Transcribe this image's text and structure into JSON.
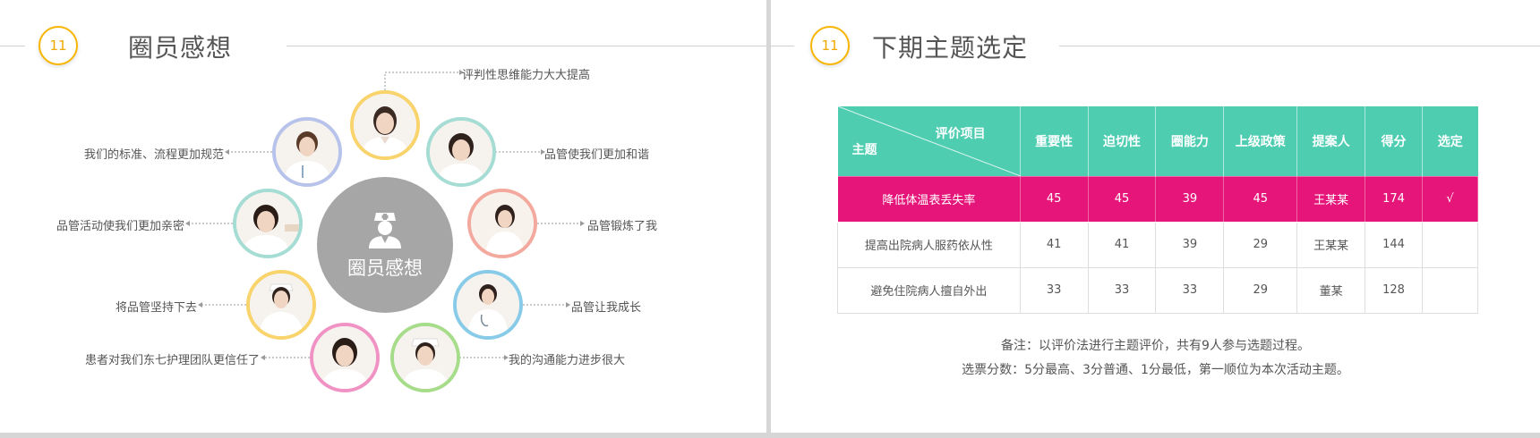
{
  "left": {
    "number": "11",
    "title": "圈员感想",
    "center_label": "圈员感想",
    "quotes": [
      "评判性思维能力大大提高",
      "品管使我们更加和谐",
      "品管锻炼了我",
      "品管让我成长",
      "我的沟通能力进步很大",
      "患者对我们东七护理团队更信任了",
      "将品管坚持下去",
      "品管活动使我们更加亲密",
      "我们的标准、流程更加规范"
    ],
    "photo_ring_colors": [
      "#f9d36b",
      "#a5dcd3",
      "#f3a99d",
      "#88cbe8",
      "#a6dc8a",
      "#f093c4",
      "#f9d36b",
      "#a5dcd3",
      "#b7c3ea"
    ]
  },
  "right": {
    "number": "11",
    "title": "下期主题选定",
    "table": {
      "diag_top": "评价项目",
      "diag_bottom": "主题",
      "headers": [
        "重要性",
        "迫切性",
        "圈能力",
        "上级政策",
        "提案人",
        "得分",
        "选定"
      ],
      "rows": [
        [
          "降低体温表丢失率",
          "45",
          "45",
          "39",
          "45",
          "王某某",
          "174",
          "√"
        ],
        [
          "提高出院病人服药依从性",
          "41",
          "41",
          "39",
          "29",
          "王某某",
          "144",
          ""
        ],
        [
          "避免住院病人擅自外出",
          "33",
          "33",
          "33",
          "29",
          "董某",
          "128",
          ""
        ]
      ]
    },
    "notes": [
      "备注：以评价法进行主题评价，共有9人参与选题过程。",
      "选票分数：5分最高、3分普通、1分最低，第一顺位为本次活动主题。"
    ]
  },
  "colors": {
    "accent_yellow": "#f7b500",
    "table_header": "#4ecdb1",
    "highlight_row": "#e5157a",
    "center_circle": "#a6a6a6"
  }
}
